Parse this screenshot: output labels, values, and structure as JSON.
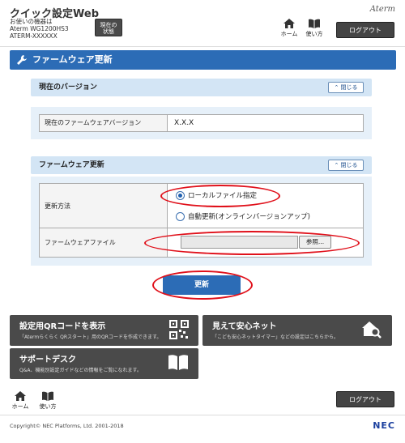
{
  "header": {
    "app_title": "クイック設定Web",
    "device_lines": [
      "お使いの機器は",
      "Aterm WG1200HS3",
      "ATERM-XXXXXX"
    ],
    "status_button_lines": [
      "現在の",
      "状態"
    ],
    "brand": "Aterm",
    "home_label": "ホーム",
    "help_label": "使い方",
    "logout_label": "ログアウト"
  },
  "page": {
    "title": "ファームウェア更新"
  },
  "version_panel": {
    "heading": "現在のバージョン",
    "close_label": "閉じる",
    "row_label": "現在のファームウェアバージョン",
    "row_value": "X.X.X"
  },
  "update_panel": {
    "heading": "ファームウェア更新",
    "close_label": "閉じる",
    "method_label": "更新方法",
    "options": [
      {
        "label": "ローカルファイル指定",
        "checked": true
      },
      {
        "label": "自動更新(オンラインバージョンアップ)",
        "checked": false
      }
    ],
    "file_label": "ファームウェアファイル",
    "file_value": "",
    "browse_label": "参照..."
  },
  "update_button": "更新",
  "tiles": [
    {
      "title": "設定用QRコードを表示",
      "desc": "「Atermらくらく QRスタート」用のQRコードを作成できます。",
      "icon": "qr-code-icon"
    },
    {
      "title": "見えて安心ネット",
      "desc": "「こども安心ネットタイマー」などの設定はこちらから。",
      "icon": "home-search-icon"
    },
    {
      "title": "サポートデスク",
      "desc": "Q&A、機能別設定ガイドなどの情報をご覧になれます。",
      "icon": "book-icon"
    }
  ],
  "footer": {
    "home_label": "ホーム",
    "help_label": "使い方",
    "logout_label": "ログアウト",
    "copyright": "Copyright© NEC Platforms, Ltd. 2001-2018",
    "brand": "NEC"
  },
  "colors": {
    "accent": "#2c6cb6",
    "panel_head": "#d3e5f5",
    "annotation": "#e0101a"
  }
}
